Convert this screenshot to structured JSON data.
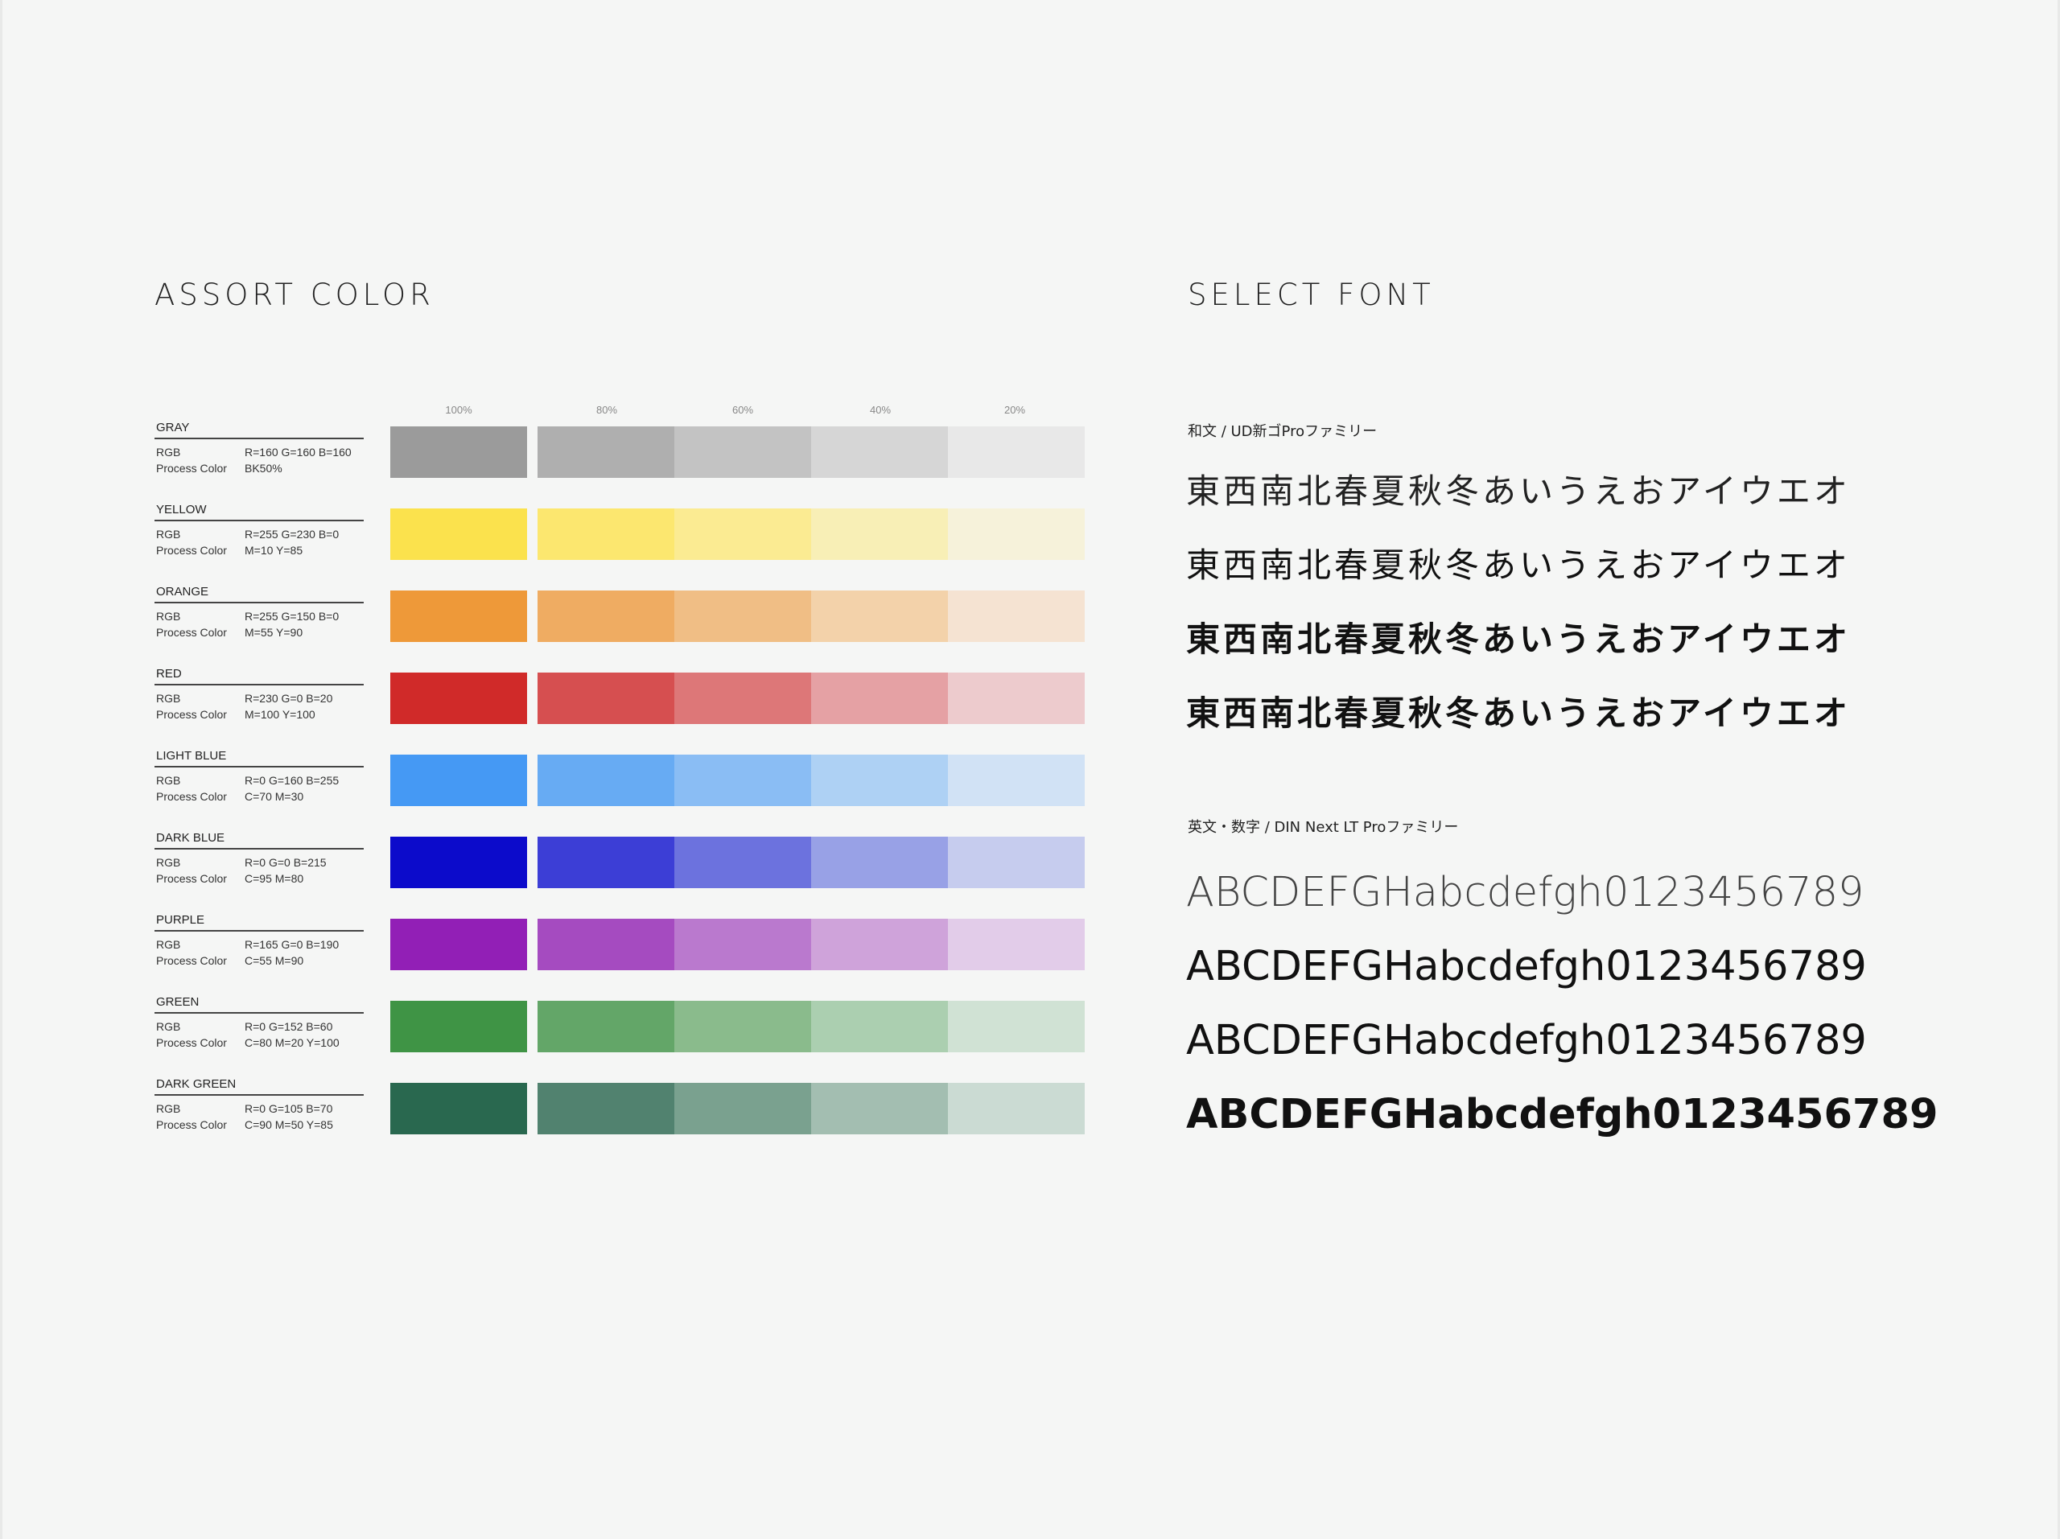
{
  "assort_color": {
    "title": "ASSORT COLOR",
    "percent_labels": [
      "100%",
      "80%",
      "60%",
      "40%",
      "20%"
    ],
    "rgb_label": "RGB",
    "process_label": "Process Color",
    "colors": [
      {
        "name": "GRAY",
        "rgb": "R=160 G=160 B=160",
        "process": "BK50%",
        "hex": "#a0a0a0"
      },
      {
        "name": "YELLOW",
        "rgb": "R=255 G=230 B=0",
        "process": "M=10 Y=85",
        "hex": "#ffe600"
      },
      {
        "name": "ORANGE",
        "rgb": "R=255 G=150 B=0",
        "process": "M=55 Y=90",
        "hex": "#ff9600"
      },
      {
        "name": "RED",
        "rgb": "R=230 G=0 B=20",
        "process": "M=100 Y=100",
        "hex": "#e60014"
      },
      {
        "name": "LIGHT BLUE",
        "rgb": "R=0 G=160 B=255",
        "process": "C=70 M=30",
        "hex": "#00a0ff"
      },
      {
        "name": "DARK BLUE",
        "rgb": "R=0 G=0 B=215",
        "process": "C=95 M=80",
        "hex": "#0000d7"
      },
      {
        "name": "PURPLE",
        "rgb": "R=165 G=0 B=190",
        "process": "C=55 M=90",
        "hex": "#a500be"
      },
      {
        "name": "GREEN",
        "rgb": "R=0 G=152 B=60",
        "process": "C=80 M=20 Y=100",
        "hex": "#00983c"
      },
      {
        "name": "DARK GREEN",
        "rgb": "R=0 G=105 B=70",
        "process": "C=90 M=50 Y=85",
        "hex": "#006946"
      }
    ],
    "swatch_colors": [
      [
        "#9b9b9b",
        "#afafaf",
        "#c3c3c3",
        "#d6d6d6",
        "#e8e8e8"
      ],
      [
        "#fbe24d",
        "#fce76f",
        "#fbeb92",
        "#f8efb6",
        "#f6f2da"
      ],
      [
        "#ee9939",
        "#efac62",
        "#f0be85",
        "#f3d2aa",
        "#f5e3d2"
      ],
      [
        "#d02a29",
        "#d64f50",
        "#dd7778",
        "#e5a1a4",
        "#edcbcd"
      ],
      [
        "#4599f4",
        "#67abf3",
        "#8abdf4",
        "#aed1f4",
        "#d1e2f5"
      ],
      [
        "#0c0bcb",
        "#3c3ed6",
        "#6c72de",
        "#98a1e6",
        "#c6ccee"
      ],
      [
        "#921fb6",
        "#a54bc0",
        "#ba79ce",
        "#cfa3da",
        "#e2cce9"
      ],
      [
        "#3f9445",
        "#63a668",
        "#8abb8c",
        "#abcfb0",
        "#d0e2d4"
      ],
      [
        "#29684f",
        "#51826f",
        "#7aa18f",
        "#a3beb1",
        "#cbdbd3"
      ]
    ]
  },
  "select_font": {
    "title": "SELECT FONT",
    "japanese_label": "和文 / UD新ゴProファミリー",
    "japanese_sample": "東西南北春夏秋冬あいうえおアイウエオ",
    "english_label": "英文・数字 / DIN Next LT Proファミリー",
    "english_sample": "ABCDEFGHabcdefgh0123456789"
  }
}
